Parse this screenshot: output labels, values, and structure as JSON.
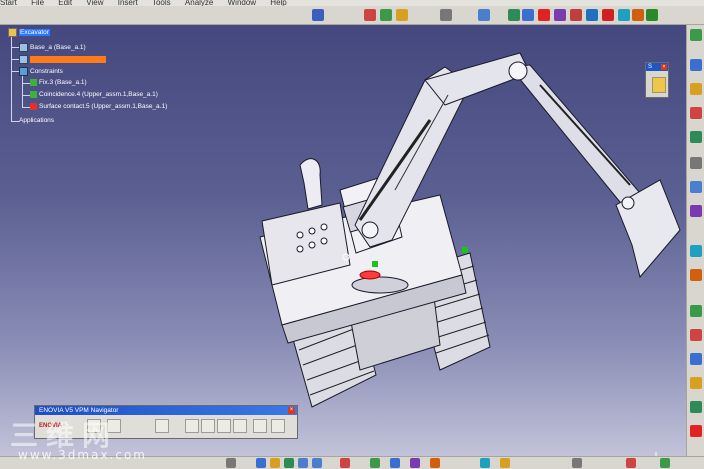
{
  "menubar": {
    "items": [
      "Start",
      "File",
      "Edit",
      "View",
      "Insert",
      "Tools",
      "Analyze",
      "Window",
      "Help"
    ]
  },
  "spec_tree": {
    "root": "Excavator",
    "items": [
      {
        "label": "Base_a (Base_a.1)"
      },
      {
        "label": ""
      },
      {
        "label": "Constraints"
      },
      {
        "label": "Fix.3 (Base_a.1)"
      },
      {
        "label": "Coincidence.4 (Upper_assm.1,Base_a.1)"
      },
      {
        "label": "Surface contact.5 (Upper_assm.1,Base_a.1)"
      },
      {
        "label": "Applications"
      }
    ]
  },
  "float_toolbar": {
    "title": "S",
    "close": "×"
  },
  "vpm_navigator": {
    "title": "ENOVIA V5 VPM Navigator",
    "close": "×",
    "logo": "ENOVIA"
  },
  "watermark": {
    "text": "三维网",
    "url": "www.3dmax.com"
  },
  "colors": {
    "viewport_top": "#44487e",
    "viewport_bottom": "#c2c3d9",
    "selection": "#2a78ff",
    "highlight_bar": "#ff7a1a"
  },
  "icons": [
    "select-arrow-icon",
    "compass-icon",
    "constraint-icon",
    "product-icon",
    "part-icon"
  ]
}
